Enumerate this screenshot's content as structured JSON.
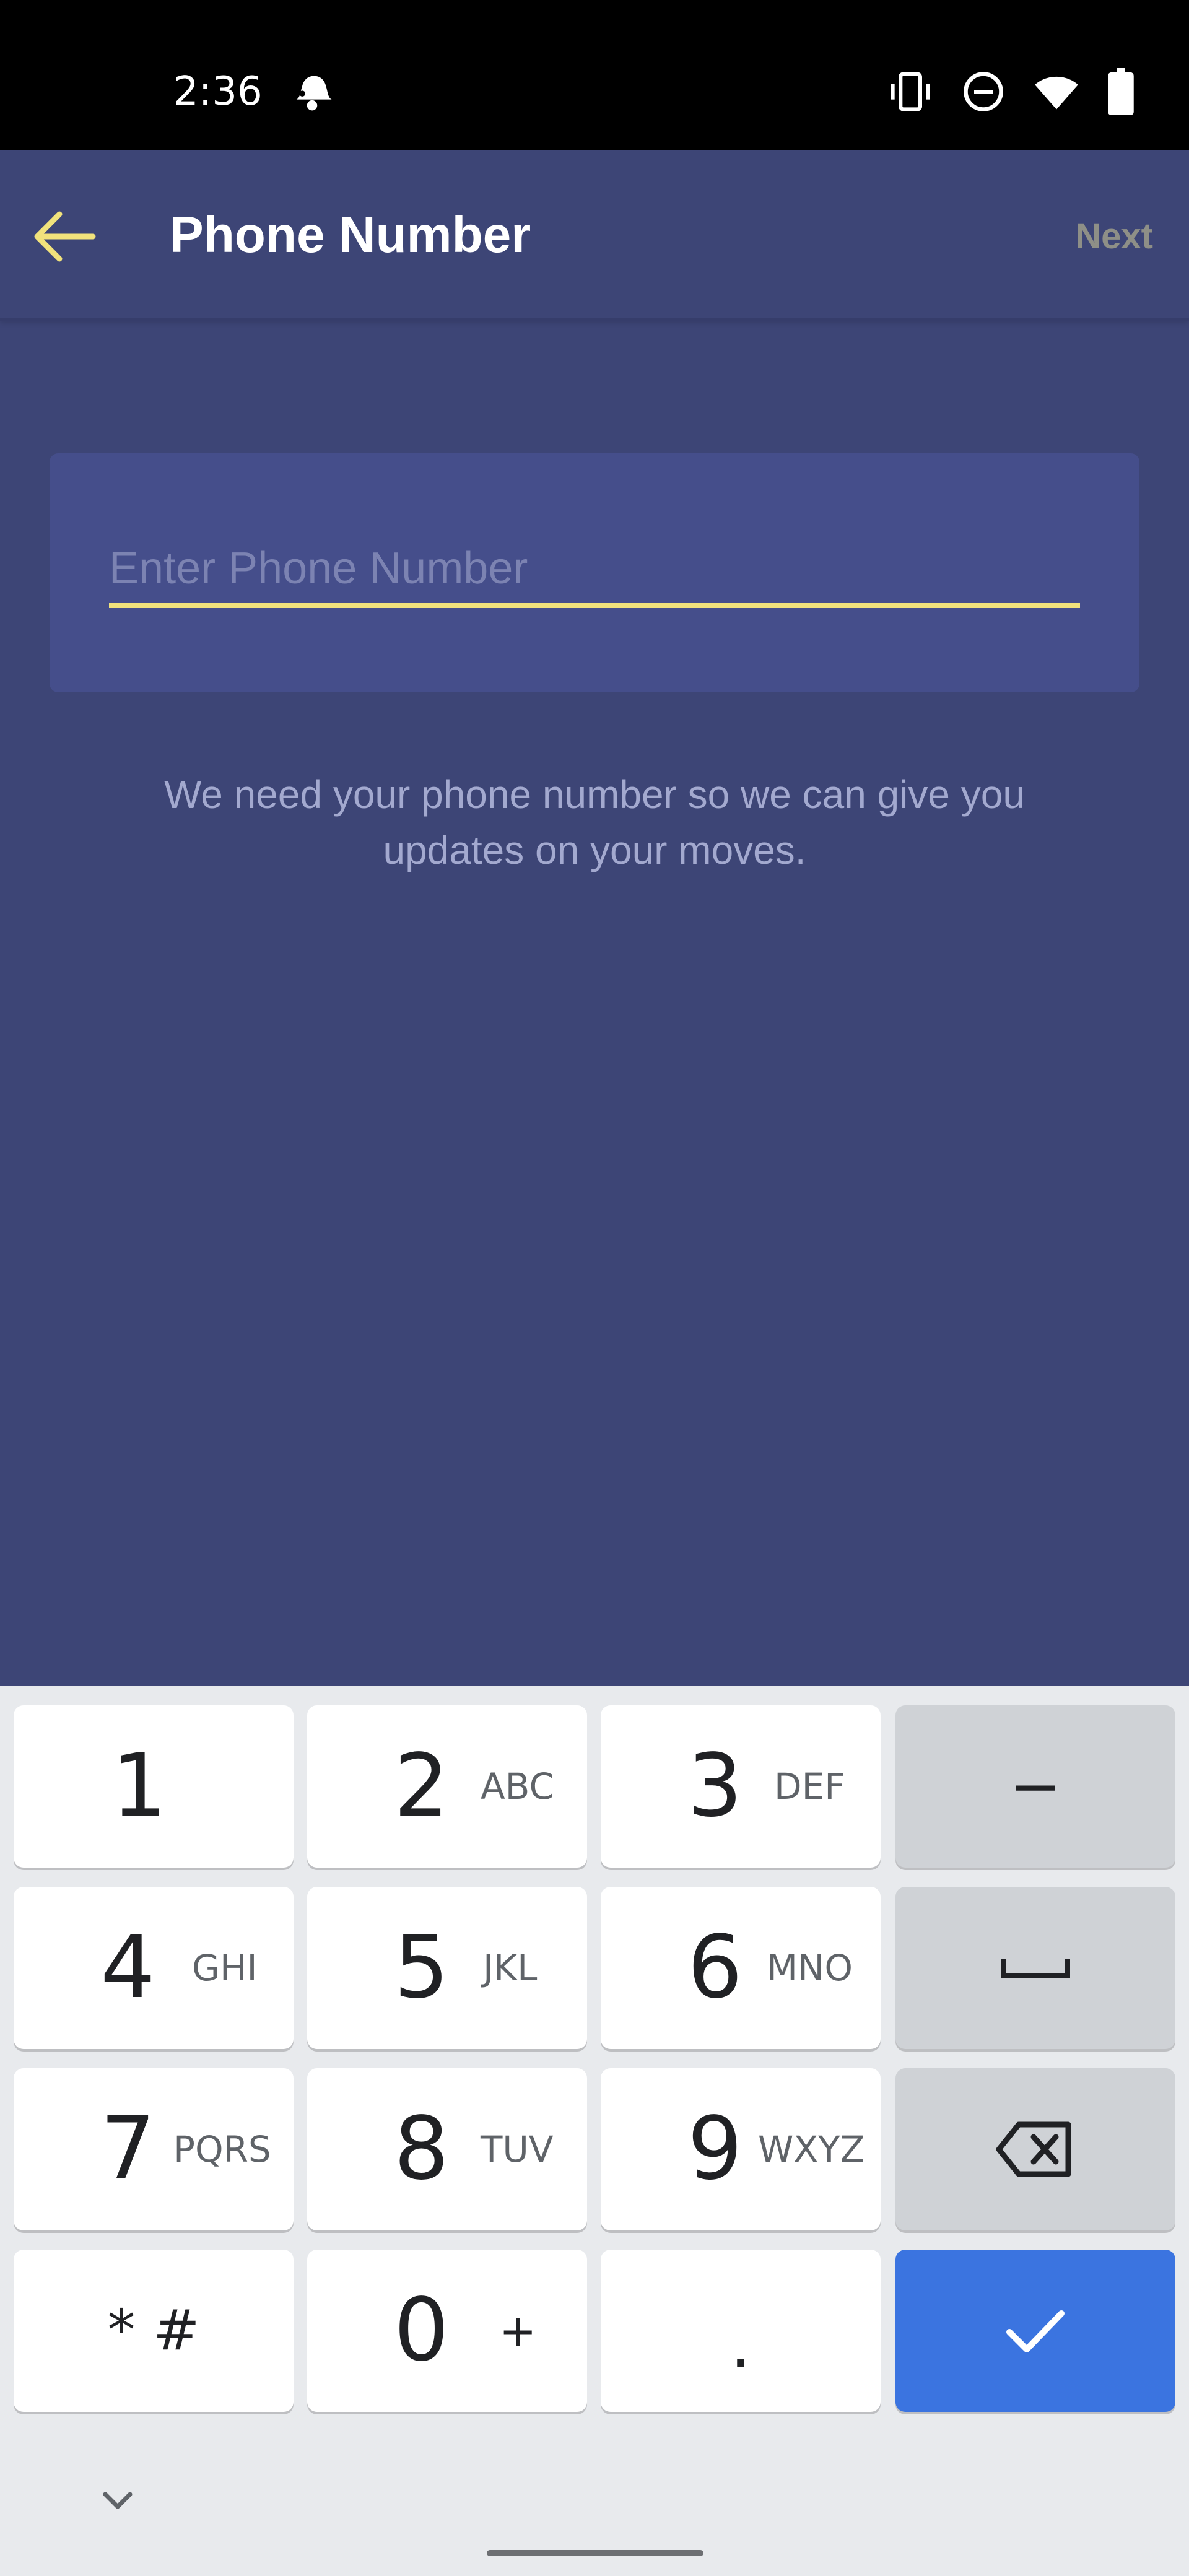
{
  "status_bar": {
    "time": "2:36",
    "icons": [
      "notification-icon",
      "vibrate-icon",
      "do-not-disturb-icon",
      "wifi-icon",
      "battery-icon"
    ]
  },
  "app_bar": {
    "back_icon": "arrow-left-icon",
    "title": "Phone Number",
    "next_label": "Next"
  },
  "form": {
    "phone_placeholder": "Enter Phone Number",
    "phone_value": "",
    "helper_text": "We need your phone number so we can give you updates on your moves."
  },
  "keyboard": {
    "keys": [
      {
        "num": "1",
        "letters": ""
      },
      {
        "num": "2",
        "letters": "ABC"
      },
      {
        "num": "3",
        "letters": "DEF"
      },
      {
        "num": "−",
        "letters": ""
      },
      {
        "num": "4",
        "letters": "GHI"
      },
      {
        "num": "5",
        "letters": "JKL"
      },
      {
        "num": "6",
        "letters": "MNO"
      },
      {
        "num": "space",
        "letters": ""
      },
      {
        "num": "7",
        "letters": "PQRS"
      },
      {
        "num": "8",
        "letters": "TUV"
      },
      {
        "num": "9",
        "letters": "WXYZ"
      },
      {
        "num": "backspace",
        "letters": ""
      },
      {
        "num": "* #",
        "letters": ""
      },
      {
        "num": "0",
        "letters": "+"
      },
      {
        "num": ".",
        "letters": ""
      },
      {
        "num": "done",
        "letters": ""
      }
    ]
  },
  "colors": {
    "background": "#3d4576",
    "card": "#454e8b",
    "accent_yellow": "#f1e27c",
    "keyboard_accent": "#3b74e0"
  }
}
